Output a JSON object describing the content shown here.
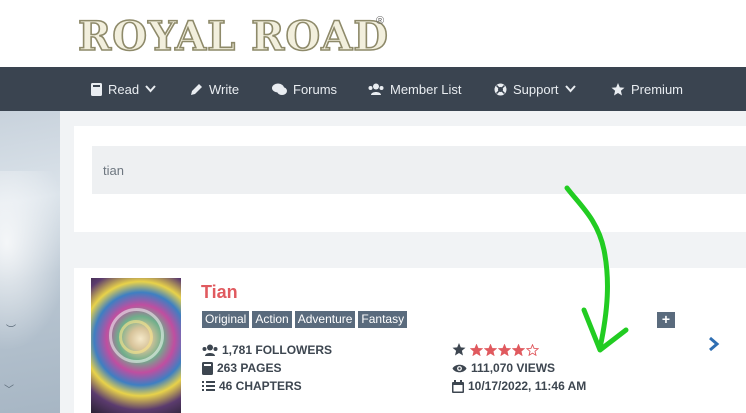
{
  "brand": {
    "logo_text": "ROYAL ROAD",
    "registered_mark": "®",
    "colors": {
      "logo_fill": "#f0ecd8",
      "logo_stroke": "#9a8f5a",
      "nav_bg": "#3a4450"
    }
  },
  "nav": {
    "items": [
      {
        "label": "Read",
        "icon": "book-icon",
        "has_dropdown": true
      },
      {
        "label": "Write",
        "icon": "pencil-icon",
        "has_dropdown": false
      },
      {
        "label": "Forums",
        "icon": "comments-icon",
        "has_dropdown": false
      },
      {
        "label": "Member List",
        "icon": "users-icon",
        "has_dropdown": false
      },
      {
        "label": "Support",
        "icon": "life-ring-icon",
        "has_dropdown": true
      },
      {
        "label": "Premium",
        "icon": "star-icon",
        "has_dropdown": false
      }
    ]
  },
  "search": {
    "value": "tian"
  },
  "result": {
    "title": "Tian",
    "tags": [
      "Original",
      "Action",
      "Adventure",
      "Fantasy"
    ],
    "add_button_label": "+",
    "next_icon": "chevron-right-icon",
    "followers": "1,781 FOLLOWERS",
    "pages": "263 PAGES",
    "chapters": "46 CHAPTERS",
    "rating": 4,
    "rating_max": 5,
    "views": "111,070 VIEWS",
    "updated": "10/17/2022, 11:46 AM",
    "colors": {
      "title": "#e05a5f",
      "tag_bg": "#5a6b7d",
      "star_fill": "#e05a5f"
    }
  },
  "annotation": {
    "color": "#22cc22",
    "shape": "hand-drawn-arrow"
  }
}
